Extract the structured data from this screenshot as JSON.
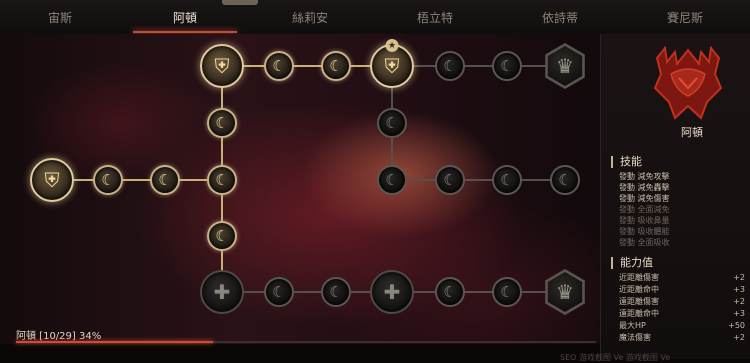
{
  "tabs": [
    {
      "label": "宙斯",
      "active": false
    },
    {
      "label": "阿頓",
      "active": true
    },
    {
      "label": "絲莉安",
      "active": false
    },
    {
      "label": "梧立特",
      "active": false
    },
    {
      "label": "依詩蒂",
      "active": false
    },
    {
      "label": "賽尼斯",
      "active": false
    }
  ],
  "panel": {
    "character_name": "阿頓",
    "skills_title": "技能",
    "skills": [
      {
        "label": "發動 減免攻擊",
        "active": true
      },
      {
        "label": "發動 減免轟擊",
        "active": true
      },
      {
        "label": "發動 減免傷害",
        "active": true
      },
      {
        "label": "發動 全面減免",
        "active": false
      },
      {
        "label": "發動 吸收鼻量",
        "active": false
      },
      {
        "label": "發動 吸收體能",
        "active": false
      },
      {
        "label": "發動 全面吸收",
        "active": false
      }
    ],
    "stats_title": "能力值",
    "stats": [
      {
        "label": "近距離傷害",
        "value": "+2"
      },
      {
        "label": "近距離命中",
        "value": "+3"
      },
      {
        "label": "遠距離傷害",
        "value": "+2"
      },
      {
        "label": "遠距離命中",
        "value": "+3"
      },
      {
        "label": "最大HP",
        "value": "+50"
      },
      {
        "label": "魔法傷害",
        "value": "+2"
      }
    ]
  },
  "progress": {
    "label": "阿頓 [10/29] 34%",
    "points": 10,
    "max_points": 29,
    "percent": 34
  },
  "colors": {
    "accent": "#c44a3a",
    "gold": "#c8b285",
    "emblem": "#a8281c"
  },
  "icons": {
    "minor_node": "crescent-moon-icon",
    "major_node": "shield-emblem-icon",
    "mastery_node": "hexagon-crest-icon"
  },
  "bottom_text": "SEO 游戏截图 Ve 游戏截图 Ve"
}
